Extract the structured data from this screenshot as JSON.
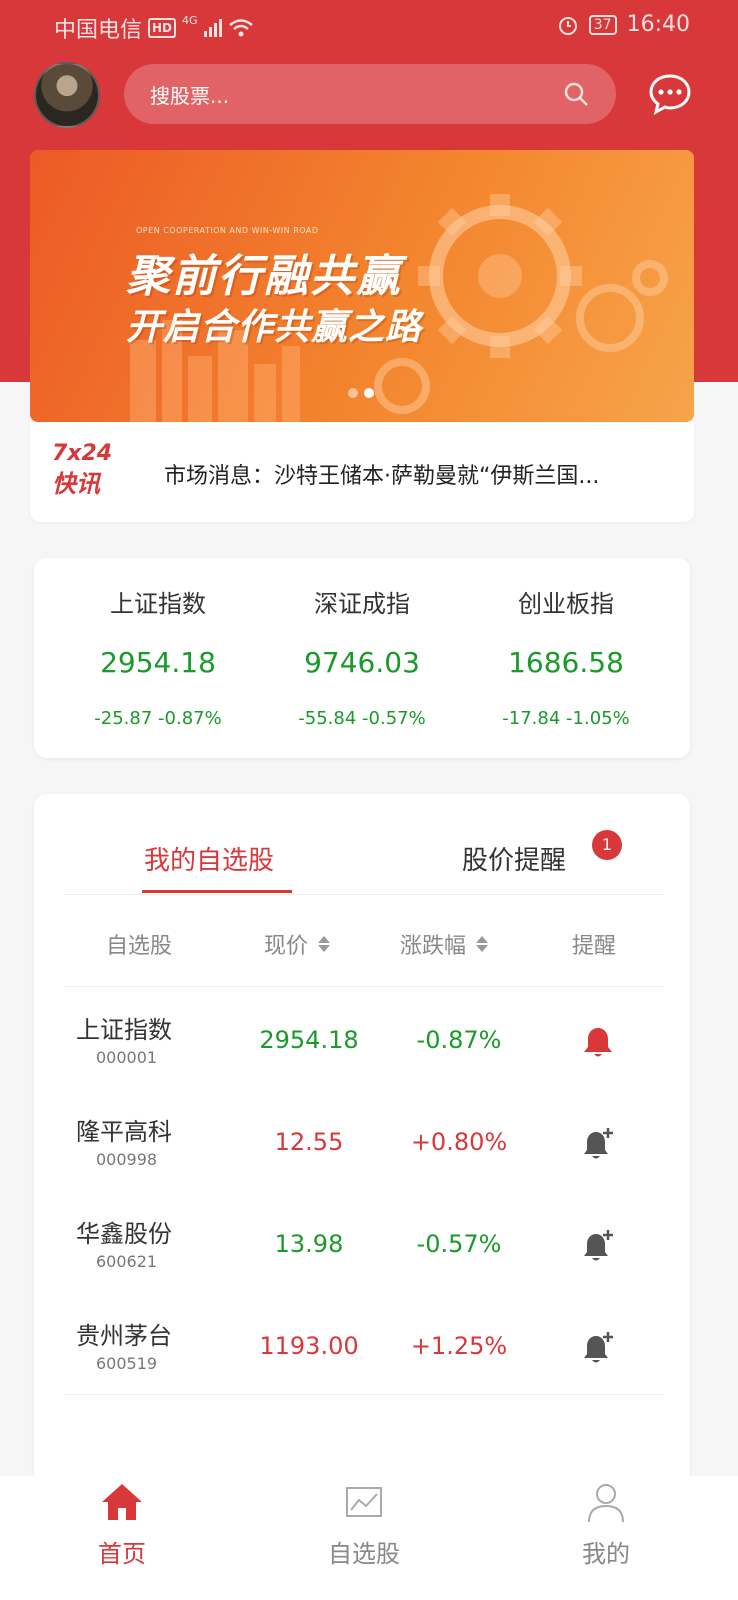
{
  "status_bar": {
    "carrier": "中国电信",
    "hd": "HD",
    "network": "4G",
    "battery": "37",
    "time": "16:40"
  },
  "header": {
    "search_placeholder": "搜股票..."
  },
  "banner": {
    "subtitle": "OPEN COOPERATION AND WIN-WIN ROAD",
    "title_line1": "聚前行融共赢",
    "title_line2": "开启合作共赢之路",
    "slide_count": 2,
    "active_slide": 2
  },
  "news": {
    "logo_top": "7x24",
    "logo_bottom": "快讯",
    "text": "市场消息：沙特王储本·萨勒曼就“伊斯兰国..."
  },
  "indices": [
    {
      "name": "上证指数",
      "value": "2954.18",
      "change": "-25.87  -0.87%"
    },
    {
      "name": "深证成指",
      "value": "9746.03",
      "change": "-55.84  -0.57%"
    },
    {
      "name": "创业板指",
      "value": "1686.58",
      "change": "-17.84  -1.05%"
    }
  ],
  "watchlist": {
    "tabs": [
      {
        "label": "我的自选股",
        "active": true
      },
      {
        "label": "股价提醒",
        "badge": "1"
      }
    ],
    "columns": {
      "stock": "自选股",
      "price": "现价",
      "change": "涨跌幅",
      "alert": "提醒"
    },
    "rows": [
      {
        "name": "上证指数",
        "code": "000001",
        "price": "2954.18",
        "change": "-0.87%",
        "direction": "down",
        "alert_set": true
      },
      {
        "name": "隆平高科",
        "code": "000998",
        "price": "12.55",
        "change": "+0.80%",
        "direction": "up",
        "alert_set": false
      },
      {
        "name": "华鑫股份",
        "code": "600621",
        "price": "13.98",
        "change": "-0.57%",
        "direction": "down",
        "alert_set": false
      },
      {
        "name": "贵州茅台",
        "code": "600519",
        "price": "1193.00",
        "change": "+1.25%",
        "direction": "up",
        "alert_set": false
      }
    ]
  },
  "bottom_nav": [
    {
      "label": "首页",
      "icon": "home-icon",
      "active": true
    },
    {
      "label": "自选股",
      "icon": "chart-icon",
      "active": false
    },
    {
      "label": "我的",
      "icon": "user-icon",
      "active": false
    }
  ],
  "colors": {
    "brand_red": "#d9383a",
    "down_green": "#1a9a2a",
    "up_red": "#d9383a"
  }
}
